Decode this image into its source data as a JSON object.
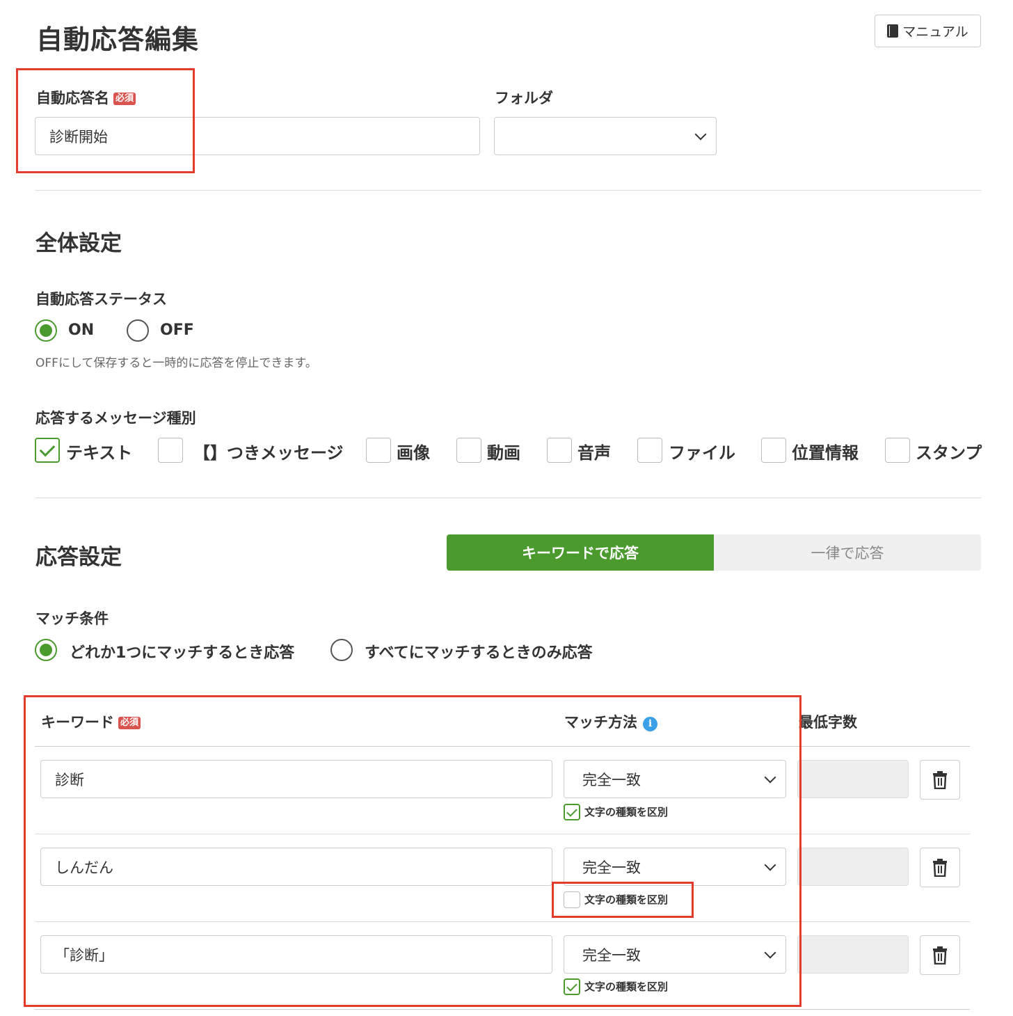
{
  "header": {
    "title": "自動応答編集",
    "manual_label": "マニュアル",
    "manual_icon": "book-icon"
  },
  "name_field": {
    "label": "自動応答名",
    "required_badge": "必須",
    "value": "診断開始"
  },
  "folder_field": {
    "label": "フォルダ",
    "value": ""
  },
  "general": {
    "title": "全体設定",
    "status_label": "自動応答ステータス",
    "status_options": [
      {
        "label": "ON",
        "selected": true
      },
      {
        "label": "OFF",
        "selected": false
      }
    ],
    "status_help": "OFFにして保存すると一時的に応答を停止できます。",
    "types_label": "応答するメッセージ種別",
    "types": [
      {
        "label": "テキスト",
        "checked": true
      },
      {
        "label": "【】つきメッセージ",
        "checked": false
      },
      {
        "label": "画像",
        "checked": false
      },
      {
        "label": "動画",
        "checked": false
      },
      {
        "label": "音声",
        "checked": false
      },
      {
        "label": "ファイル",
        "checked": false
      },
      {
        "label": "位置情報",
        "checked": false
      },
      {
        "label": "スタンプ",
        "checked": false
      }
    ]
  },
  "response": {
    "title": "応答設定",
    "mode_tabs": [
      {
        "label": "キーワードで応答",
        "active": true
      },
      {
        "label": "一律で応答",
        "active": false
      }
    ],
    "match_label": "マッチ条件",
    "match_options": [
      {
        "label": "どれか1つにマッチするとき応答",
        "selected": true
      },
      {
        "label": "すべてにマッチするときのみ応答",
        "selected": false
      }
    ],
    "table": {
      "col_keyword": "キーワード",
      "required_badge": "必須",
      "col_method": "マッチ方法",
      "col_minchars": "最低字数",
      "rows": [
        {
          "keyword": "診断",
          "method": "完全一致",
          "distinguish_label": "文字の種類を区別",
          "distinguish": true
        },
        {
          "keyword": "しんだん",
          "method": "完全一致",
          "distinguish_label": "文字の種類を区別",
          "distinguish": false
        },
        {
          "keyword": "「診断」",
          "method": "完全一致",
          "distinguish_label": "文字の種類を区別",
          "distinguish": true
        }
      ]
    }
  },
  "colors": {
    "accent": "#4a9a2e",
    "badge": "#d9534f",
    "highlight": "#e53b2c",
    "info": "#3aa0e8"
  }
}
